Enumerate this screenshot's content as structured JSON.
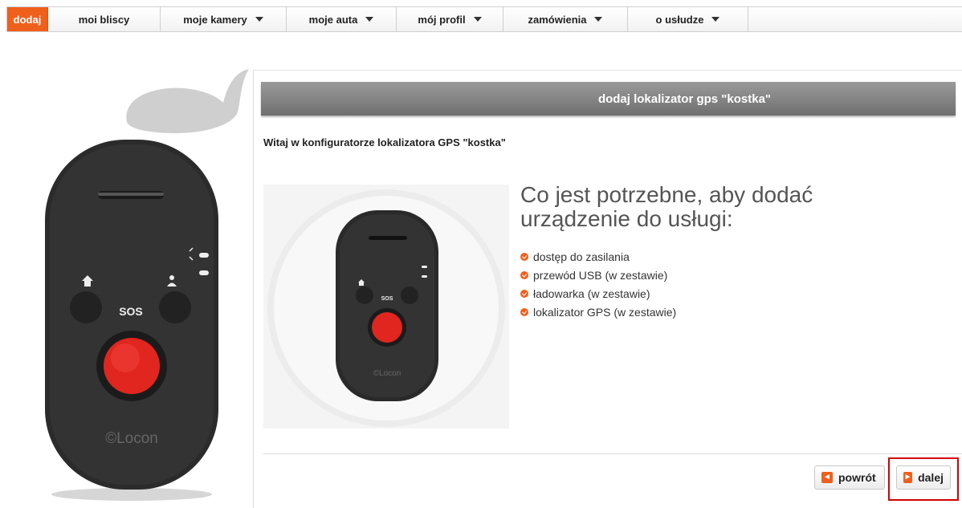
{
  "nav": {
    "items": [
      {
        "label": "dodaj",
        "active": true,
        "dropdown": false
      },
      {
        "label": "moi bliscy",
        "active": false,
        "dropdown": false
      },
      {
        "label": "moje kamery",
        "active": false,
        "dropdown": true
      },
      {
        "label": "moje auta",
        "active": false,
        "dropdown": true
      },
      {
        "label": "mój profil",
        "active": false,
        "dropdown": true
      },
      {
        "label": "zamówienia",
        "active": false,
        "dropdown": true
      },
      {
        "label": "o usłudze",
        "active": false,
        "dropdown": true
      }
    ]
  },
  "device": {
    "sos_label": "SOS",
    "brand": "©Locon",
    "sos_label_small": "SOS",
    "brand_small": "©Locon"
  },
  "panel": {
    "header": "dodaj lokalizator gps \"kostka\"",
    "welcome": "Witaj w konfiguratorze lokalizatora GPS \"kostka\"",
    "requirements_title": "Co jest potrzebne, aby dodać urządzenie do usługi:",
    "requirements": [
      "dostęp do zasilania",
      "przewód USB (w zestawie)",
      "ładowarka (w zestawie)",
      "lokalizator GPS (w zestawie)"
    ]
  },
  "buttons": {
    "back_label": "powrót",
    "next_label": "dalej"
  },
  "colors": {
    "accent": "#f0601d",
    "highlight": "#d20000"
  },
  "icons": {
    "back": "arrow-left-icon",
    "next": "arrow-right-icon",
    "bullet": "check-bullet-icon",
    "dropdown": "caret-down-icon"
  }
}
